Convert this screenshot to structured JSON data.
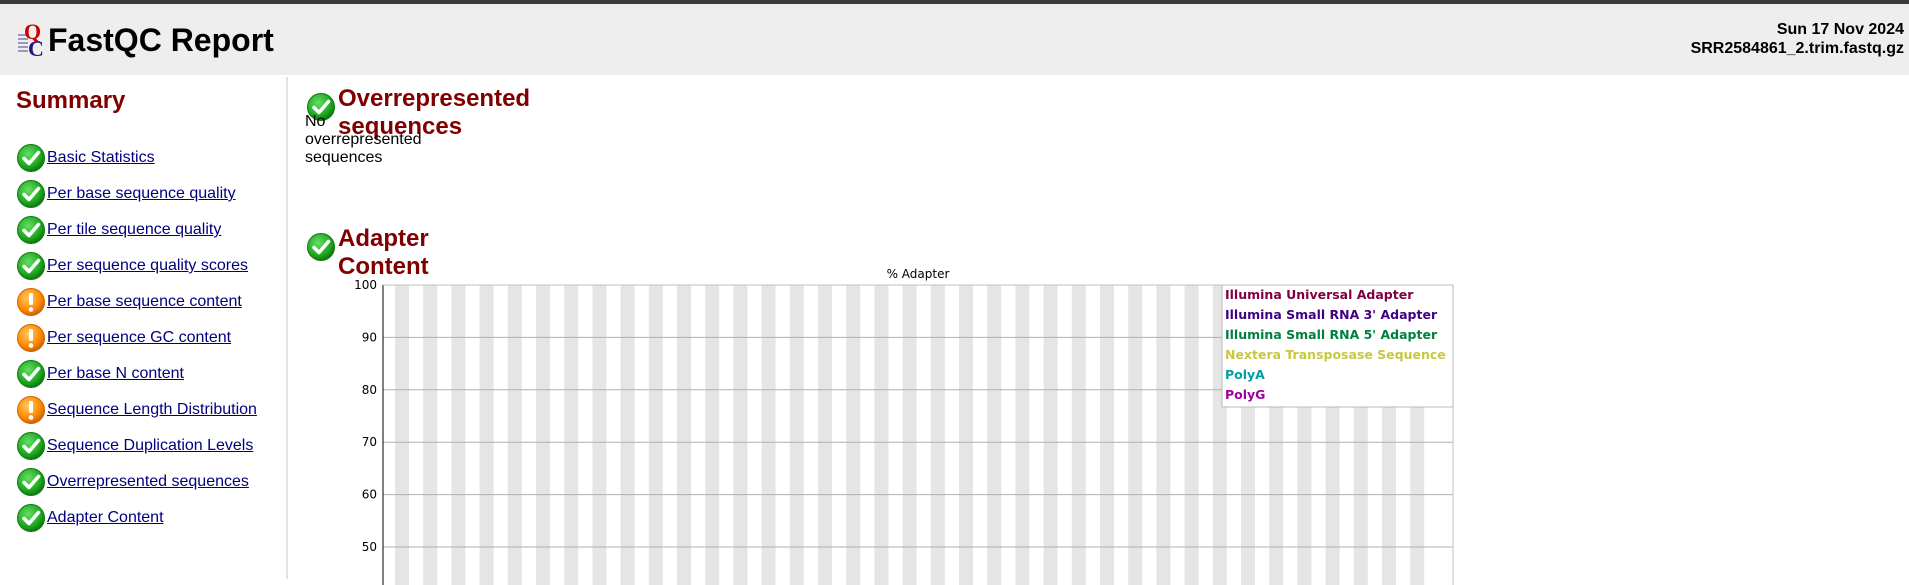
{
  "header": {
    "title": "FastQC Report",
    "date": "Sun 17 Nov 2024",
    "filename": "SRR2584861_2.trim.fastq.gz"
  },
  "sidebar": {
    "title": "Summary",
    "items": [
      {
        "label": "Basic Statistics",
        "status": "pass"
      },
      {
        "label": "Per base sequence quality",
        "status": "pass"
      },
      {
        "label": "Per tile sequence quality",
        "status": "pass"
      },
      {
        "label": "Per sequence quality scores",
        "status": "pass"
      },
      {
        "label": "Per base sequence content",
        "status": "warn"
      },
      {
        "label": "Per sequence GC content",
        "status": "warn"
      },
      {
        "label": "Per base N content",
        "status": "pass"
      },
      {
        "label": "Sequence Length Distribution",
        "status": "warn"
      },
      {
        "label": "Sequence Duplication Levels",
        "status": "pass"
      },
      {
        "label": "Overrepresented sequences",
        "status": "pass"
      },
      {
        "label": "Adapter Content",
        "status": "pass"
      }
    ]
  },
  "main": {
    "overrepresented": {
      "title": "Overrepresented sequences",
      "status": "pass",
      "message": "No overrepresented sequences"
    },
    "adapter": {
      "title": "Adapter Content",
      "status": "pass"
    }
  },
  "colors": {
    "pass": "#22aa22",
    "warn": "#ff9900",
    "section_title": "#800000",
    "link": "#000080"
  },
  "chart_data": {
    "type": "line",
    "title": "% Adapter",
    "ylim": [
      0,
      100
    ],
    "y_ticks_visible": [
      100,
      90,
      80,
      70,
      60,
      50
    ],
    "grid": true,
    "legend_position": "top-right",
    "series": [
      {
        "name": "Illumina Universal Adapter",
        "color": "#800040"
      },
      {
        "name": "Illumina Small RNA 3' Adapter",
        "color": "#400080"
      },
      {
        "name": "Illumina Small RNA 5' Adapter",
        "color": "#008040"
      },
      {
        "name": "Nextera Transposase Sequence",
        "color": "#c8c840"
      },
      {
        "name": "PolyA",
        "color": "#00a0a0"
      },
      {
        "name": "PolyG",
        "color": "#a000a0"
      }
    ]
  }
}
